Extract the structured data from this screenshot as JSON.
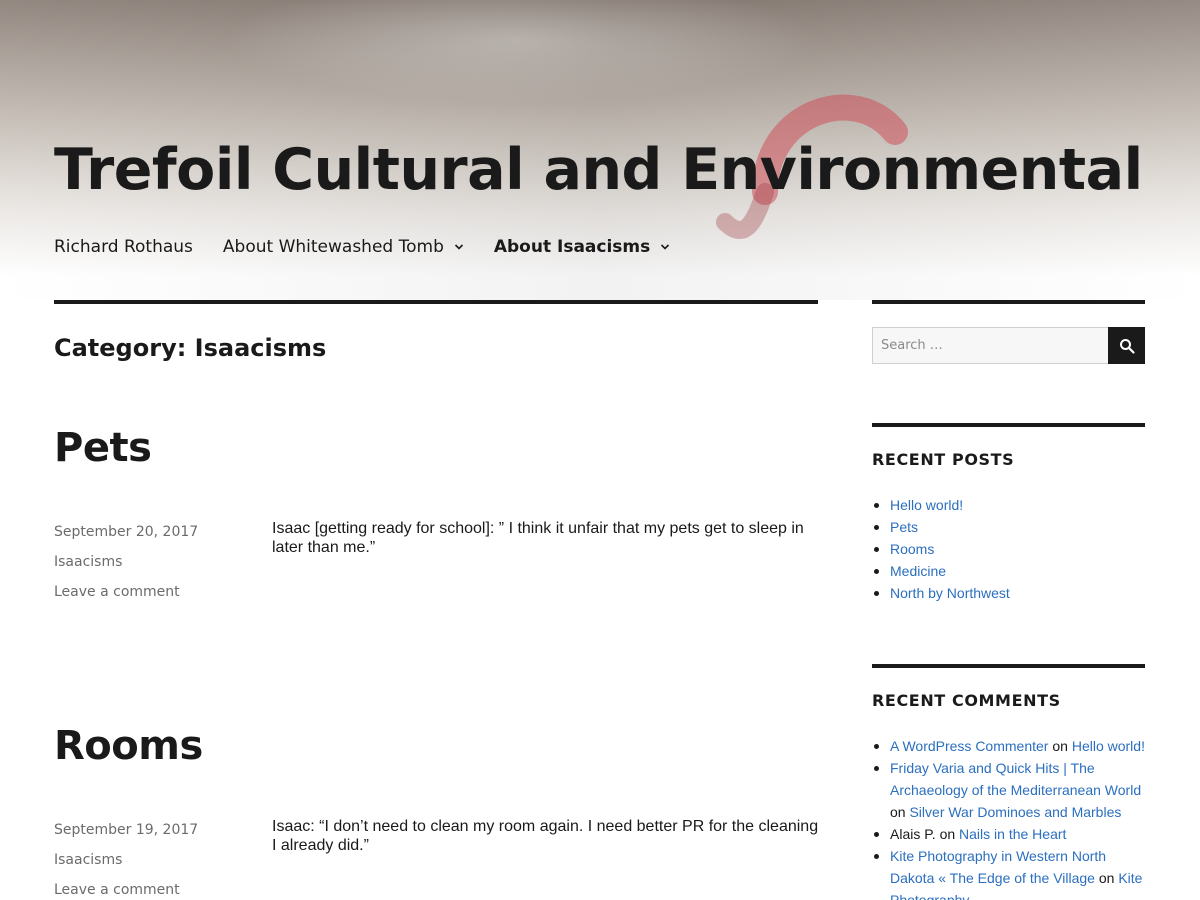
{
  "site": {
    "title": "Trefoil Cultural and Environmental"
  },
  "nav": {
    "items": [
      {
        "label": "Richard Rothaus",
        "has_dropdown": false
      },
      {
        "label": "About Whitewashed Tomb",
        "has_dropdown": true
      },
      {
        "label": "About Isaacisms",
        "has_dropdown": true,
        "current": true
      }
    ]
  },
  "archive": {
    "title": "Category: Isaacisms"
  },
  "posts": [
    {
      "title": "Pets",
      "date": "September 20, 2017",
      "category": "Isaacisms",
      "comments_link": "Leave a comment",
      "excerpt": "Isaac [getting ready for school]: ” I think it unfair that my pets get to sleep in later than me.”"
    },
    {
      "title": "Rooms",
      "date": "September 19, 2017",
      "category": "Isaacisms",
      "comments_link": "Leave a comment",
      "excerpt": "Isaac: “I don’t need to clean my room again. I need better PR for the cleaning I already did.”"
    }
  ],
  "sidebar": {
    "search": {
      "placeholder": "Search …",
      "icon": "search-icon"
    },
    "recent_posts": {
      "title": "RECENT POSTS",
      "items": [
        "Hello world!",
        "Pets",
        "Rooms",
        "Medicine",
        "North by Northwest"
      ]
    },
    "recent_comments": {
      "title": "RECENT COMMENTS",
      "items": [
        {
          "author": "A WordPress Commenter",
          "on": "on",
          "post": "Hello world!"
        },
        {
          "author": "Friday Varia and Quick Hits | The Archaeology of the Mediterranean World",
          "on": "on",
          "post": "Silver War Dominoes and Marbles"
        },
        {
          "author": "Alais P.",
          "on": "on",
          "post": "Nails in the Heart"
        },
        {
          "author": "Kite Photography in Western North Dakota « The Edge of the Village",
          "on": "on",
          "post": "Kite Photography"
        }
      ]
    }
  },
  "colors": {
    "text": "#1a1a1a",
    "link": "#2b6fbf",
    "meta": "#6b6b6b"
  }
}
